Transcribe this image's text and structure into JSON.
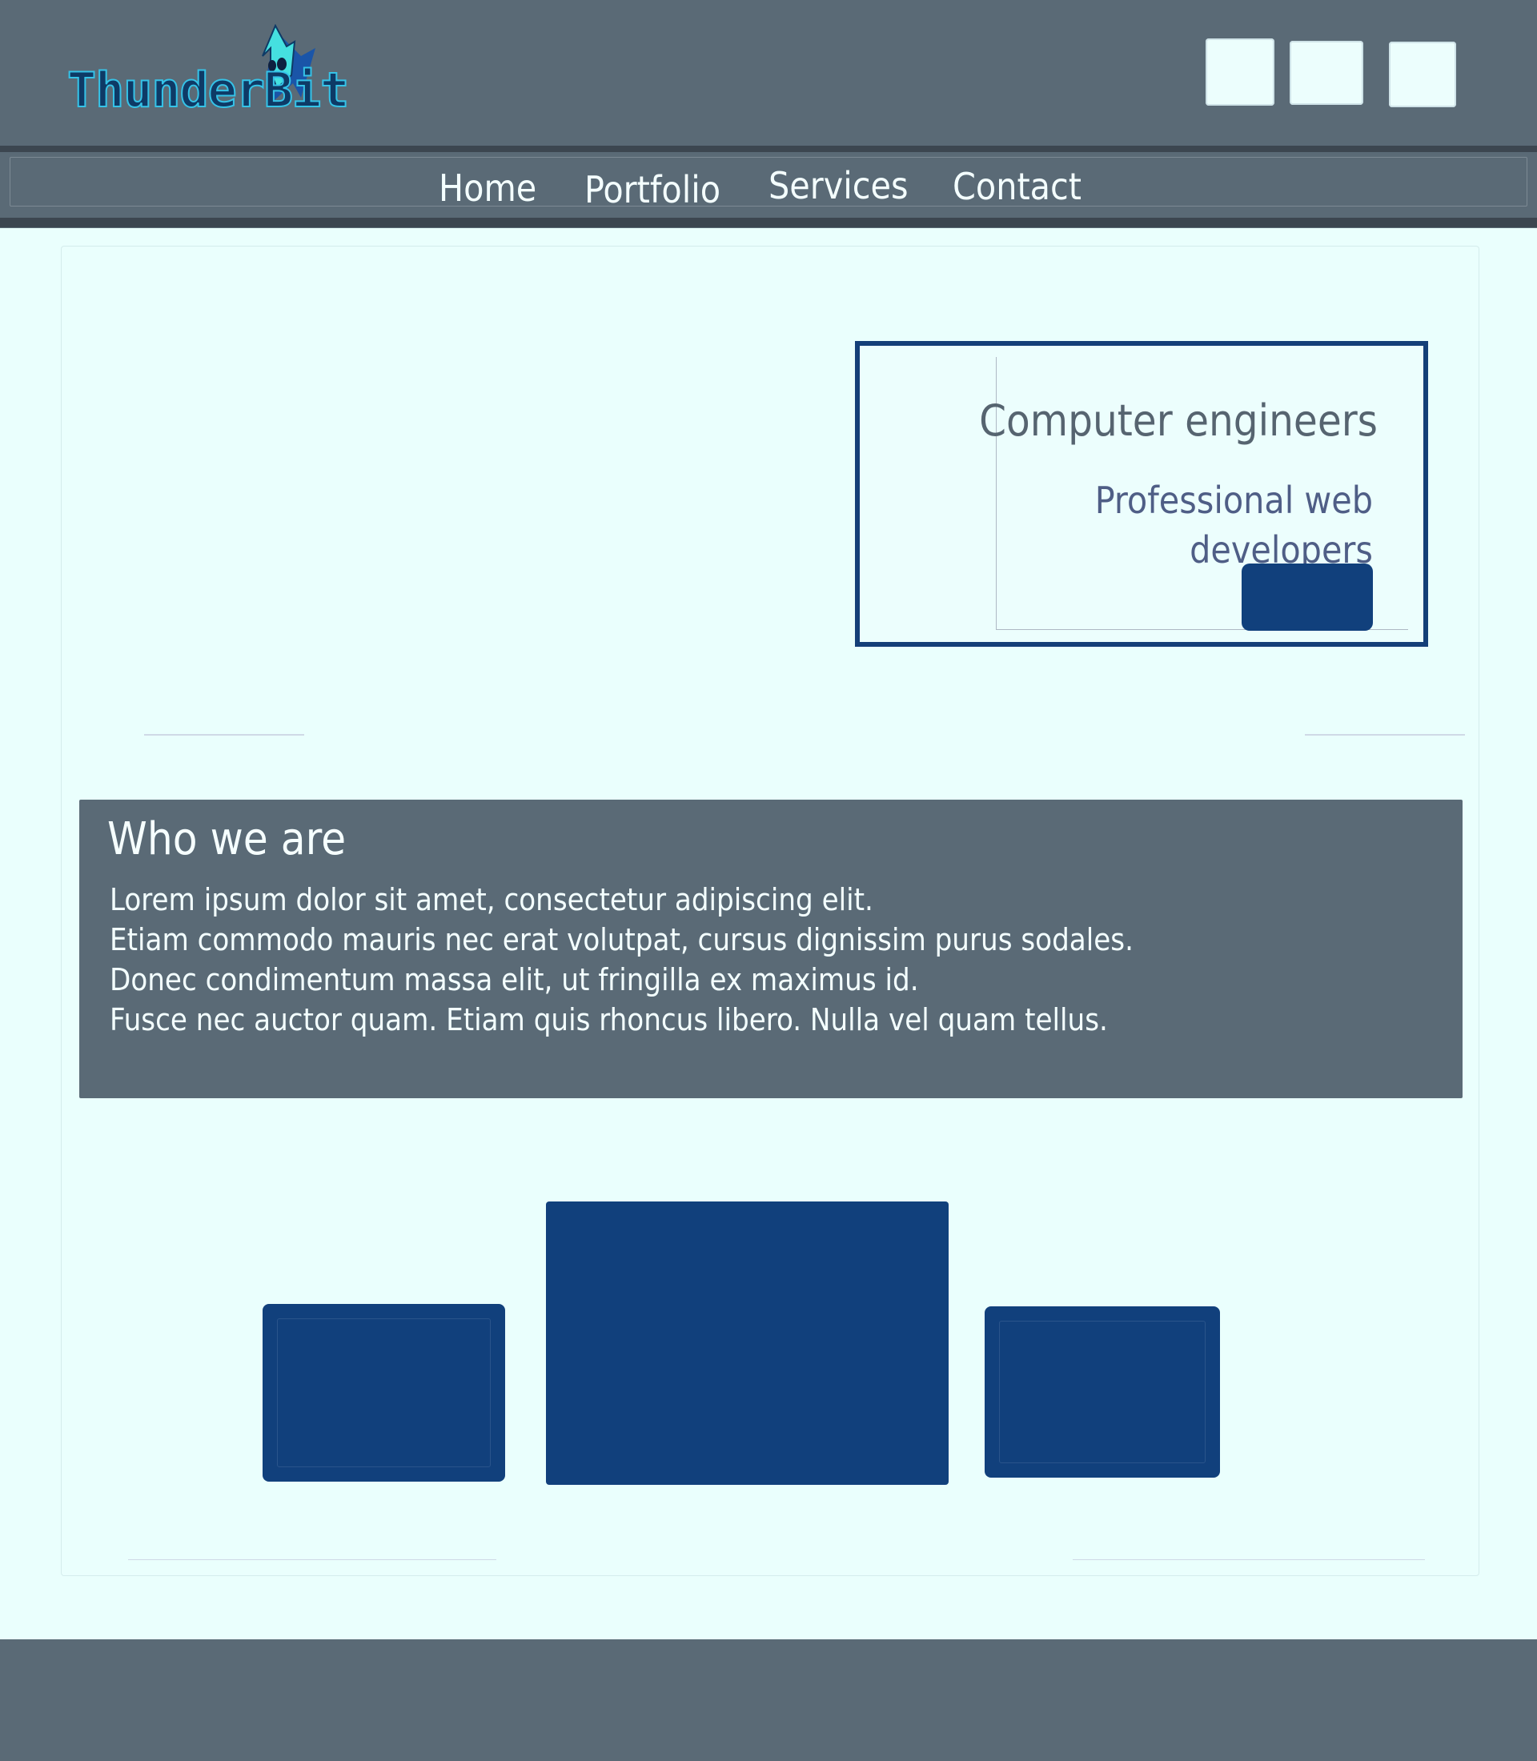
{
  "brand": {
    "logo_text": "ThunderBit",
    "logo_icon": "lightning-bolt-creature-icon"
  },
  "header": {
    "actions": [
      {
        "icon": "placeholder-square-icon"
      },
      {
        "icon": "placeholder-square-icon"
      },
      {
        "icon": "placeholder-square-icon"
      }
    ]
  },
  "nav": {
    "items": [
      {
        "label": "Home"
      },
      {
        "label": "Portfolio"
      },
      {
        "label": "Services"
      },
      {
        "label": "Contact"
      }
    ]
  },
  "hero": {
    "title": "Computer engineers",
    "subtitle": "Professional web developers"
  },
  "about": {
    "title": "Who we are",
    "lines": [
      "Lorem ipsum dolor sit amet, consectetur adipiscing elit.",
      "Etiam commodo mauris nec erat volutpat, cursus dignissim purus sodales.",
      "Donec condimentum massa elit, ut fringilla ex maximus id.",
      "Fusce nec auctor quam. Etiam quis rhoncus libero. Nulla vel quam tellus."
    ]
  },
  "colors": {
    "header_bg": "#5a6a76",
    "page_bg": "#eafffd",
    "accent_blue": "#11407c",
    "nav_text": "#f4ffff"
  }
}
